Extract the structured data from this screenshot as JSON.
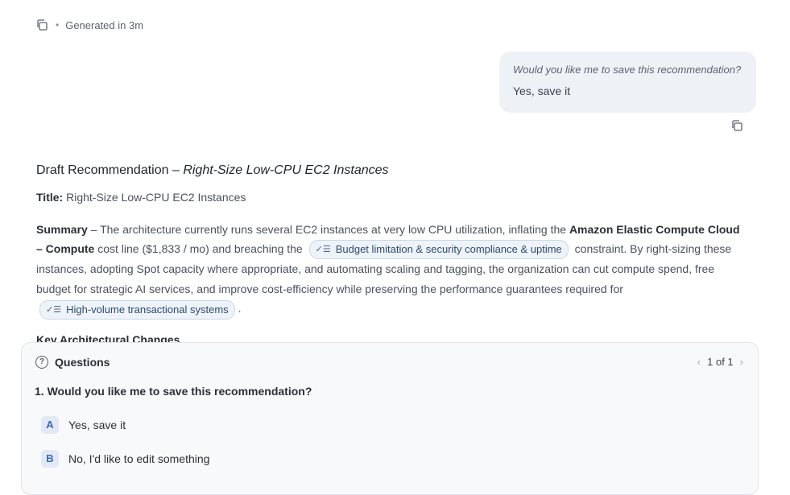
{
  "meta": {
    "status": "Generated in 3m",
    "separator": "•"
  },
  "user_message": {
    "question": "Would you like me to save this recommendation?",
    "answer": "Yes, save it"
  },
  "draft": {
    "heading_prefix": "Draft Recommendation – ",
    "heading_italic": "Right-Size Low-CPU EC2 Instances",
    "title_label": "Title:",
    "title_value": " Right-Size Low-CPU EC2 Instances",
    "summary_label": "Summary",
    "summary_part1": " – The architecture currently runs several EC2 instances at very low CPU utilization, inflating the ",
    "summary_bold1": "Amazon Elastic Compute Cloud – Compute",
    "summary_part2": " cost line ($1,833 / mo) and breaching the ",
    "chip1": "Budget limitation & security compliance & uptime",
    "summary_part3": " constraint.  By right-sizing these instances, adopting Spot capacity where appropriate, and automating scaling and tagging, the organization can cut compute spend, free budget for strategic AI services, and improve cost-efficiency while preserving the performance guarantees required for ",
    "chip2": "High-volume transactional systems",
    "summary_end": ".",
    "next_heading": "Key Architectural Changes"
  },
  "questions_panel": {
    "title": "Questions",
    "pager": "1 of 1",
    "question": "1. Would you like me to save this recommendation?",
    "options": [
      {
        "letter": "A",
        "label": "Yes, save it"
      },
      {
        "letter": "B",
        "label": "No, I'd like to edit something"
      }
    ]
  },
  "icons": {
    "copy": "copy-icon",
    "chip": "checklist-icon",
    "question": "question-circle-icon",
    "prev": "chevron-left-icon",
    "next": "chevron-right-icon"
  },
  "colors": {
    "chip_border": "#cbd6e4",
    "chip_bg": "#eef3f9",
    "option_letter": "#3867b6",
    "bubble_bg": "#eef1f5"
  }
}
